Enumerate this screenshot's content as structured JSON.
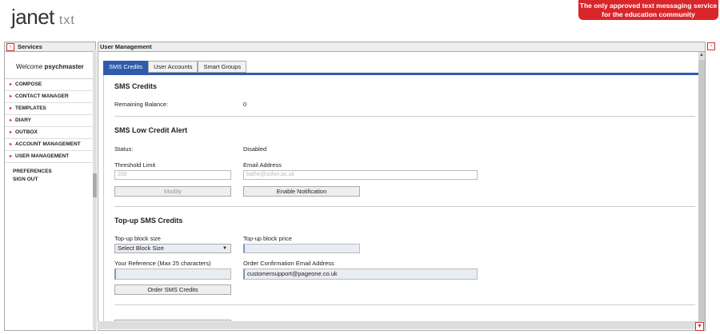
{
  "brand": {
    "logo_main": "janet",
    "logo_sub": "txt",
    "banner_line1": "The only approved text messaging service",
    "banner_line2": "for the education community"
  },
  "sidebar": {
    "title": "Services",
    "welcome_prefix": "Welcome",
    "username": "psychmaster",
    "items": [
      {
        "label": "COMPOSE"
      },
      {
        "label": "CONTACT MANAGER"
      },
      {
        "label": "TEMPLATES"
      },
      {
        "label": "DIARY"
      },
      {
        "label": "OUTBOX"
      },
      {
        "label": "ACCOUNT MANAGEMENT"
      },
      {
        "label": "USER MANAGEMENT"
      }
    ],
    "links": [
      {
        "label": "PREFERENCES"
      },
      {
        "label": "SIGN OUT"
      }
    ]
  },
  "main": {
    "title": "User Management",
    "tabs": [
      {
        "label": "SMS Credits",
        "active": true
      },
      {
        "label": "User Accounts"
      },
      {
        "label": "Smart Groups"
      }
    ],
    "credits": {
      "title": "SMS Credits",
      "balance_label": "Remaining Balance:",
      "balance_value": "0"
    },
    "alert": {
      "title": "SMS Low Credit Alert",
      "status_label": "Status:",
      "status_value": "Disabled",
      "threshold_label": "Threshold Limit",
      "threshold_placeholder": "200",
      "email_label": "Email Address",
      "email_placeholder": "bathe@solon.ac.uk",
      "modify_label": "Modify",
      "enable_label": "Enable Notification"
    },
    "topup": {
      "title": "Top-up SMS Credits",
      "block_size_label": "Top-up block size",
      "block_size_value": "Select Block Size",
      "block_price_label": "Top-up block price",
      "reference_label": "Your Reference (Max 25 characters)",
      "confirm_email_label": "Order Confirmation Email Address",
      "confirm_email_value": "customersupport@pageone.co.uk",
      "order_label": "Order SMS Credits"
    }
  }
}
